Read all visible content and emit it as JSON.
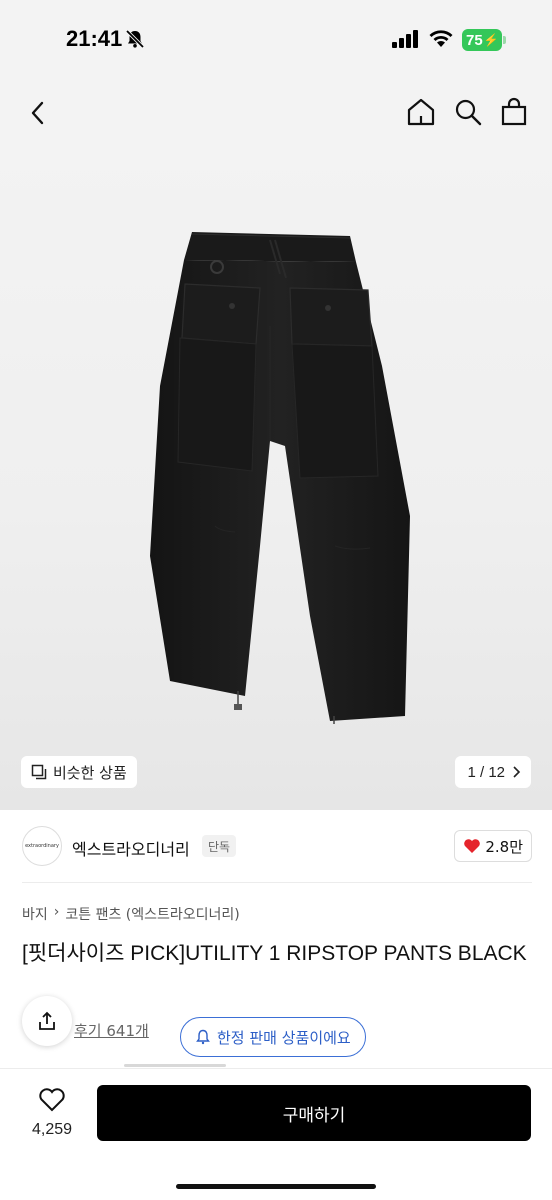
{
  "status_bar": {
    "time": "21:41",
    "battery": "75",
    "mute_icon": "bell-slash-icon"
  },
  "nav": {
    "back_icon": "chevron-left-icon",
    "home_icon": "home-icon",
    "search_icon": "search-icon",
    "cart_icon": "shopping-bag-icon"
  },
  "gallery": {
    "similar_label": "비슷한 상품",
    "page_indicator": "1 / 12",
    "current_page": 1,
    "total_pages": 12
  },
  "brand": {
    "logo_text": "extraordinary",
    "name": "엑스트라오디너리",
    "tag": "단독",
    "likes": "2.8만"
  },
  "breadcrumb": [
    "바지",
    "코튼 팬츠 (엑스트라오디너리)"
  ],
  "product": {
    "title": "[핏더사이즈 PICK]UTILITY 1 RIPSTOP PANTS BLACK",
    "review_count": "후기 641개",
    "limited_label": "한정 판매 상품이에요"
  },
  "bottom_bar": {
    "wish_count": "4,259",
    "buy_label": "구매하기"
  },
  "colors": {
    "heart": "#e5242c",
    "limited_border": "#3b6fd6",
    "buy_button": "#000000",
    "battery": "#34c759"
  }
}
